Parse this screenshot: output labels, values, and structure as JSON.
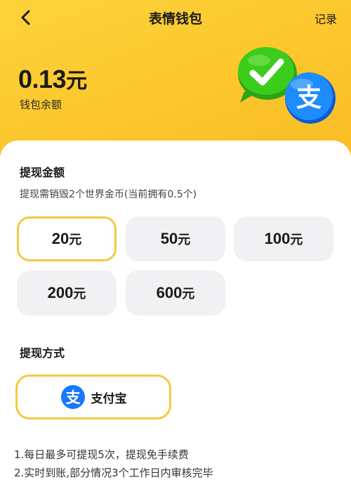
{
  "nav": {
    "title": "表情钱包",
    "record_label": "记录"
  },
  "balance": {
    "amount": "0.13",
    "unit": "元",
    "label": "钱包余额"
  },
  "withdraw": {
    "title": "提现金额",
    "hint": "提现需销毁2个世界金币(当前拥有0.5个)",
    "options": [
      {
        "value": "20",
        "unit": "元",
        "selected": true
      },
      {
        "value": "50",
        "unit": "元",
        "selected": false
      },
      {
        "value": "100",
        "unit": "元",
        "selected": false
      },
      {
        "value": "200",
        "unit": "元",
        "selected": false
      },
      {
        "value": "600",
        "unit": "元",
        "selected": false
      }
    ]
  },
  "method": {
    "title": "提现方式",
    "alipay_label": "支付宝",
    "alipay_glyph": "支"
  },
  "notes": [
    "1.每日最多可提现5次，提现免手续费",
    "2.实时到账,部分情况3个工作日内审核完毕"
  ],
  "colors": {
    "header_yellow": "#fcc62c",
    "selected_border": "#f6c845",
    "option_bg": "#f1f1f3",
    "wechat_green": "#2dc100",
    "alipay_blue": "#1677ff"
  },
  "icons": [
    "back-arrow-icon",
    "wechat-pay-icon",
    "alipay-icon"
  ]
}
